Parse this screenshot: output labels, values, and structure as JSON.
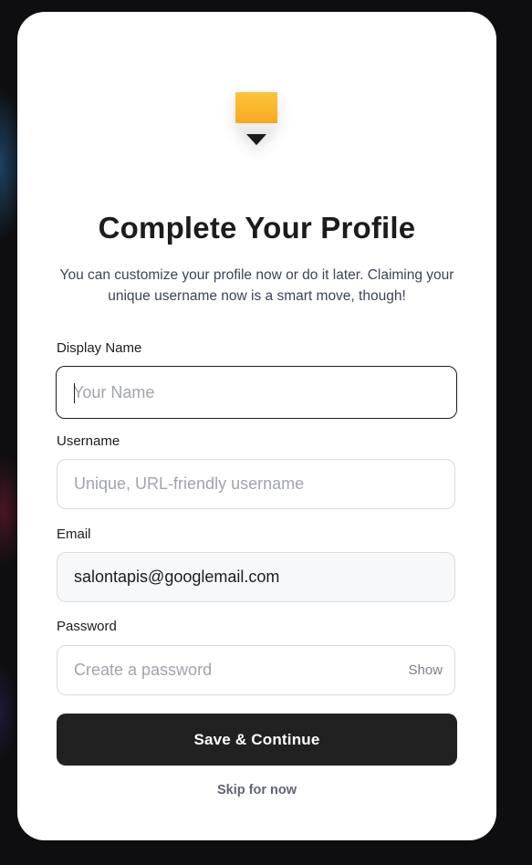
{
  "profile": {
    "title": "Complete Your Profile",
    "subtitle": "You can customize your profile now or do it later. Claiming your unique username now is a smart move, though!",
    "logo_icon": "pencil-icon",
    "fields": {
      "display_name": {
        "label": "Display Name",
        "placeholder": "Your Name",
        "value": ""
      },
      "username": {
        "label": "Username",
        "placeholder": "Unique, URL-friendly username",
        "value": ""
      },
      "email": {
        "label": "Email",
        "placeholder": "",
        "value": "salontapis@googlemail.com"
      },
      "password": {
        "label": "Password",
        "placeholder": "Create a password",
        "value": "",
        "show_label": "Show"
      }
    },
    "save_label": "Save & Continue",
    "skip_label": "Skip for now"
  },
  "colors": {
    "primary_button": "#212121",
    "logo_yellow": "#fbbf24",
    "page_background": "#0e0e10"
  }
}
